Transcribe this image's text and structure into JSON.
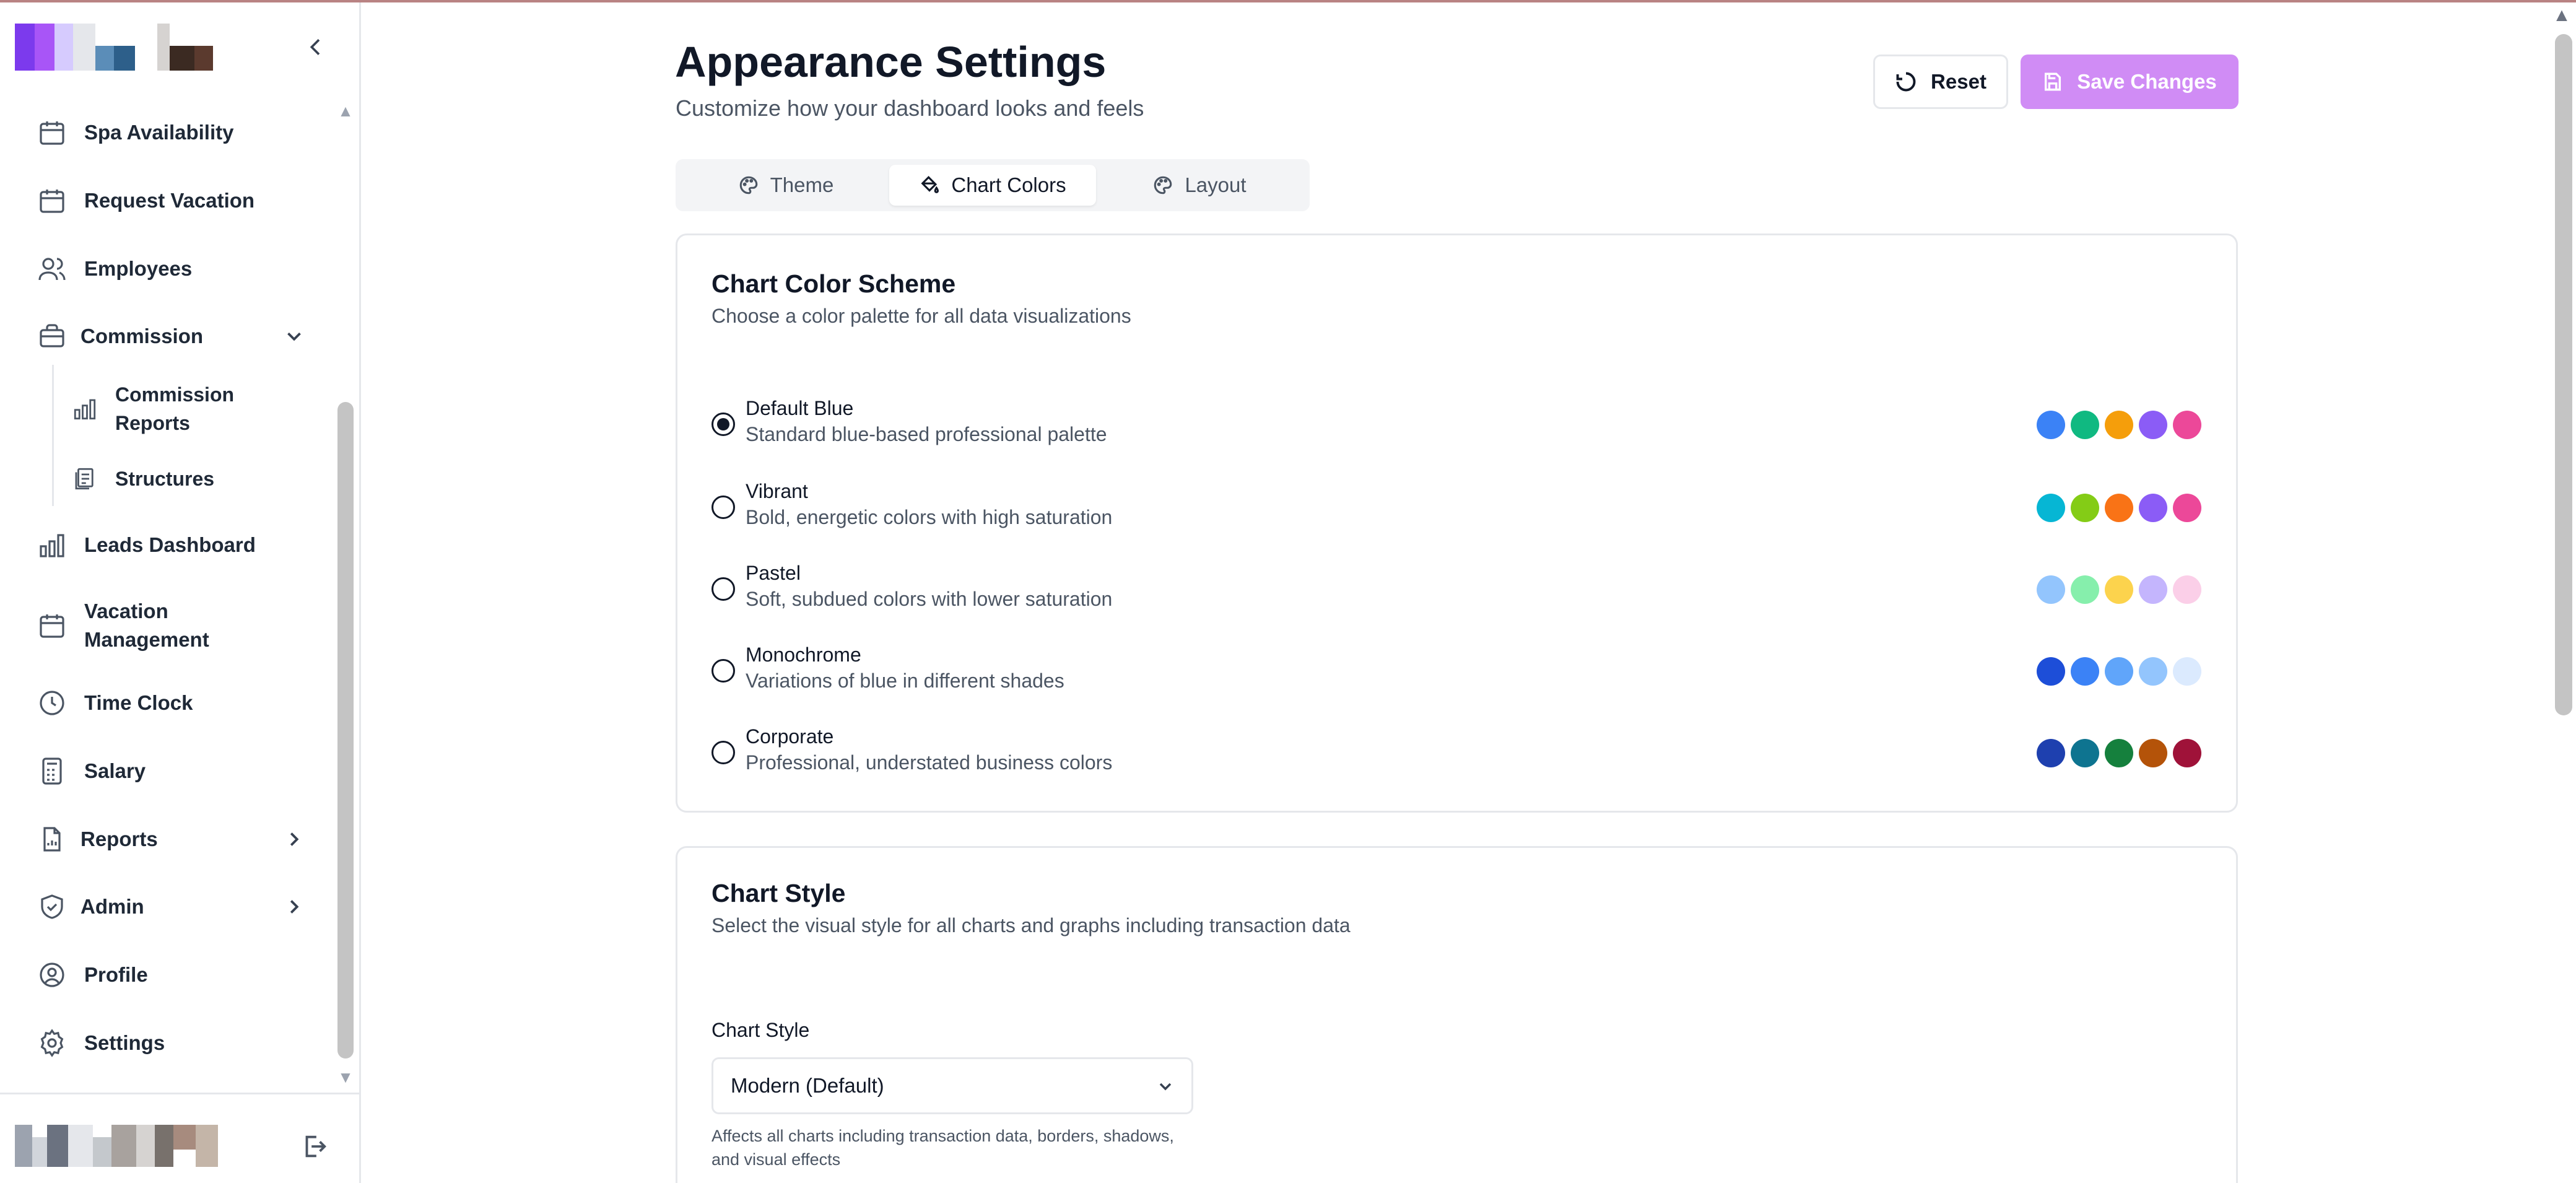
{
  "sidebar": {
    "items": [
      {
        "label": "Spa Availability",
        "icon": "calendar-icon"
      },
      {
        "label": "Request Vacation",
        "icon": "calendar-icon"
      },
      {
        "label": "Employees",
        "icon": "users-icon"
      },
      {
        "label": "Commission",
        "icon": "briefcase-icon",
        "expanded": true
      },
      {
        "label": "Leads Dashboard",
        "icon": "bar-chart-icon"
      },
      {
        "label": "Vacation Management",
        "label_line1": "Vacation",
        "label_line2": "Management",
        "icon": "calendar-icon"
      },
      {
        "label": "Time Clock",
        "icon": "clock-icon"
      },
      {
        "label": "Salary",
        "icon": "calculator-icon"
      },
      {
        "label": "Reports",
        "icon": "file-chart-icon"
      },
      {
        "label": "Admin",
        "icon": "shield-icon"
      },
      {
        "label": "Profile",
        "icon": "user-circle-icon"
      },
      {
        "label": "Settings",
        "icon": "gear-icon"
      }
    ],
    "commission_subitems": [
      {
        "label_line1": "Commission",
        "label_line2": "Reports",
        "icon": "bar-chart-icon"
      },
      {
        "label": "Structures",
        "icon": "document-stack-icon"
      }
    ]
  },
  "header": {
    "title": "Appearance Settings",
    "subtitle": "Customize how your dashboard looks and feels",
    "reset_label": "Reset",
    "save_label": "Save Changes"
  },
  "tabs": [
    {
      "label": "Theme",
      "icon": "palette-icon",
      "active": false
    },
    {
      "label": "Chart Colors",
      "icon": "paint-bucket-icon",
      "active": true
    },
    {
      "label": "Layout",
      "icon": "palette-icon",
      "active": false
    }
  ],
  "color_scheme": {
    "title": "Chart Color Scheme",
    "description": "Choose a color palette for all data visualizations",
    "selected": "Default Blue",
    "options": [
      {
        "name": "Default Blue",
        "description": "Standard blue-based professional palette",
        "colors": [
          "#3b82f6",
          "#10b981",
          "#f59e0b",
          "#8b5cf6",
          "#ec4899"
        ]
      },
      {
        "name": "Vibrant",
        "description": "Bold, energetic colors with high saturation",
        "colors": [
          "#06b6d4",
          "#84cc16",
          "#f97316",
          "#8b5cf6",
          "#ec4899"
        ]
      },
      {
        "name": "Pastel",
        "description": "Soft, subdued colors with lower saturation",
        "colors": [
          "#93c5fd",
          "#86efac",
          "#fcd34d",
          "#c4b5fd",
          "#fbcfe8"
        ]
      },
      {
        "name": "Monochrome",
        "description": "Variations of blue in different shades",
        "colors": [
          "#1d4ed8",
          "#3b82f6",
          "#60a5fa",
          "#93c5fd",
          "#dbeafe"
        ]
      },
      {
        "name": "Corporate",
        "description": "Professional, understated business colors",
        "colors": [
          "#1e40af",
          "#0e7490",
          "#15803d",
          "#b45309",
          "#9f1239"
        ]
      }
    ]
  },
  "chart_style": {
    "title": "Chart Style",
    "description": "Select the visual style for all charts and graphs including transaction data",
    "select_label": "Chart Style",
    "selected_value": "Modern (Default)",
    "help_text": "Affects all charts including transaction data, borders, shadows, and visual effects"
  },
  "colors": {
    "accent": "#d08cf5",
    "border": "#e5e7eb",
    "text_primary": "#111827",
    "text_secondary": "#4b5563"
  }
}
